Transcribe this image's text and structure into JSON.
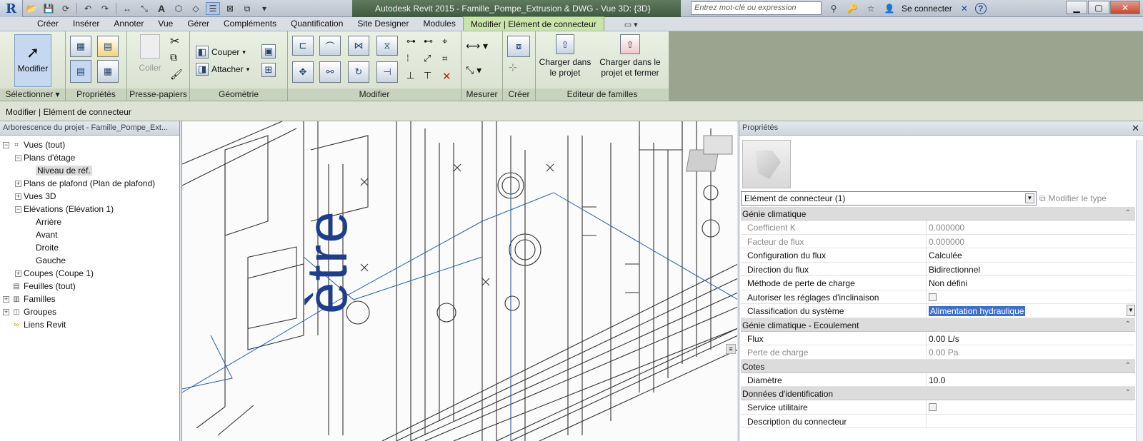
{
  "titlebar": {
    "app_logo": "R",
    "title": "Autodesk Revit 2015  -   Famille_Pompe_Extrusion & DWG - Vue 3D: {3D}",
    "search_placeholder": "Entrez mot-clé ou expression",
    "signin_label": "Se connecter",
    "help_label": "?"
  },
  "tabs": [
    "Créer",
    "Insérer",
    "Annoter",
    "Vue",
    "Gérer",
    "Compléments",
    "Quantification",
    "Site Designer",
    "Modules",
    "Modifier | Elément de connecteur"
  ],
  "ribbon": {
    "select": {
      "modify_label": "Modifier",
      "panel_label": "Sélectionner"
    },
    "properties": {
      "panel_label": "Propriétés"
    },
    "clipboard": {
      "paste_label": "Coller",
      "panel_label": "Presse-papiers"
    },
    "geometry": {
      "cut_label": "Couper",
      "join_label": "Attacher",
      "panel_label": "Géométrie"
    },
    "modify": {
      "panel_label": "Modifier"
    },
    "measure": {
      "panel_label": "Mesurer"
    },
    "create": {
      "panel_label": "Créer"
    },
    "family_editor": {
      "load_label": "Charger dans le projet",
      "load_close_label": "Charger dans le projet et fermer",
      "panel_label": "Editeur de familles"
    }
  },
  "context_bar": "Modifier | Elément de connecteur",
  "browser": {
    "title": "Arborescence du projet - Famille_Pompe_Ext...",
    "tree": [
      {
        "label": "Vues (tout)",
        "level": 0,
        "exp": "−",
        "icon": "views-icon"
      },
      {
        "label": "Plans d'étage",
        "level": 1,
        "exp": "−"
      },
      {
        "label": "Niveau de réf.",
        "level": 2,
        "exp": "",
        "selected": true
      },
      {
        "label": "Plans de plafond (Plan de plafond)",
        "level": 1,
        "exp": "+"
      },
      {
        "label": "Vues 3D",
        "level": 1,
        "exp": "+"
      },
      {
        "label": "Elévations (Elévation 1)",
        "level": 1,
        "exp": "−"
      },
      {
        "label": "Arrière",
        "level": 2,
        "exp": ""
      },
      {
        "label": "Avant",
        "level": 2,
        "exp": ""
      },
      {
        "label": "Droite",
        "level": 2,
        "exp": ""
      },
      {
        "label": "Gauche",
        "level": 2,
        "exp": ""
      },
      {
        "label": "Coupes (Coupe 1)",
        "level": 1,
        "exp": "+"
      },
      {
        "label": "Feuilles (tout)",
        "level": 0,
        "exp": "",
        "icon": "sheets-icon"
      },
      {
        "label": "Familles",
        "level": 0,
        "exp": "+",
        "icon": "families-icon"
      },
      {
        "label": "Groupes",
        "level": 0,
        "exp": "+",
        "icon": "groups-icon"
      },
      {
        "label": "Liens Revit",
        "level": 0,
        "exp": "",
        "icon": "links-icon"
      }
    ]
  },
  "canvas": {
    "overlay_text": "ètre"
  },
  "props": {
    "title": "Propriétés",
    "type_selector": "Elément de connecteur (1)",
    "edit_type_label": "Modifier le type",
    "groups": [
      {
        "name": "Génie climatique",
        "rows": [
          {
            "k": "Coefficient K",
            "v": "0.000000",
            "ro": true
          },
          {
            "k": "Facteur de flux",
            "v": "0.000000",
            "ro": true
          },
          {
            "k": "Configuration du flux",
            "v": "Calculée"
          },
          {
            "k": "Direction du flux",
            "v": "Bidirectionnel"
          },
          {
            "k": "Méthode de perte de charge",
            "v": "Non défini"
          },
          {
            "k": "Autoriser les réglages d'inclinaison",
            "v": "",
            "checkbox": true
          },
          {
            "k": "Classification du système",
            "v": "Alimentation hydraulique",
            "highlight": true
          }
        ]
      },
      {
        "name": "Génie climatique - Ecoulement",
        "rows": [
          {
            "k": "Flux",
            "v": "0.00 L/s"
          },
          {
            "k": "Perte de charge",
            "v": "0.00 Pa",
            "ro": true
          }
        ]
      },
      {
        "name": "Cotes",
        "rows": [
          {
            "k": "Diamètre",
            "v": "10.0"
          }
        ]
      },
      {
        "name": "Données d'identification",
        "rows": [
          {
            "k": "Service utilitaire",
            "v": "",
            "checkbox": true
          },
          {
            "k": "Description du connecteur",
            "v": ""
          }
        ]
      }
    ]
  }
}
